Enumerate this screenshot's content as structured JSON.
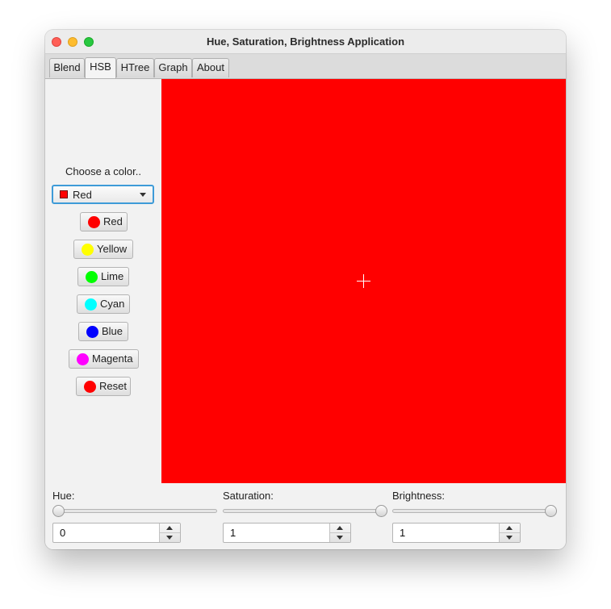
{
  "window": {
    "title": "Hue, Saturation, Brightness Application"
  },
  "tabs": [
    {
      "label": "Blend",
      "active": false
    },
    {
      "label": "HSB",
      "active": true
    },
    {
      "label": "HTree",
      "active": false
    },
    {
      "label": "Graph",
      "active": false
    },
    {
      "label": "About",
      "active": false
    }
  ],
  "sidebar": {
    "choose_label": "Choose a color..",
    "combo": {
      "value": "Red",
      "swatch_color": "#ff0000"
    },
    "buttons": [
      {
        "label": "Red",
        "color": "#ff0000"
      },
      {
        "label": "Yellow",
        "color": "#ffff00"
      },
      {
        "label": "Lime",
        "color": "#00ff00"
      },
      {
        "label": "Cyan",
        "color": "#00ffff"
      },
      {
        "label": "Blue",
        "color": "#0000ff"
      },
      {
        "label": "Magenta",
        "color": "#ff00ff"
      },
      {
        "label": "Reset",
        "color": "#ff0000"
      }
    ]
  },
  "canvas": {
    "fill_color": "#ff0000"
  },
  "controls": {
    "hue": {
      "label": "Hue:",
      "value": "0",
      "slider_fraction": 0
    },
    "saturation": {
      "label": "Saturation:",
      "value": "1",
      "slider_fraction": 1
    },
    "brightness": {
      "label": "Brightness:",
      "value": "1",
      "slider_fraction": 1
    }
  }
}
